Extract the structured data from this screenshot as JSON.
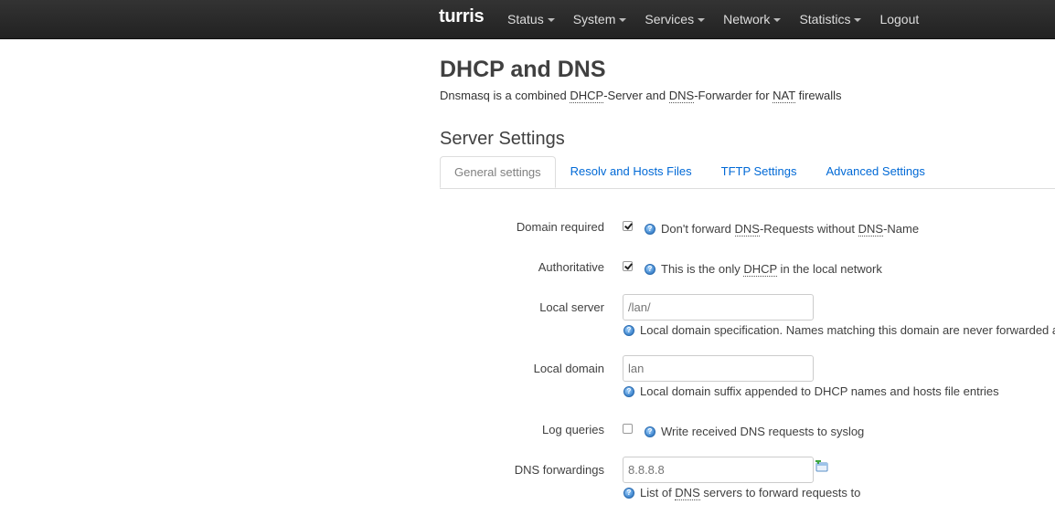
{
  "navbar": {
    "brand": "turris",
    "items": [
      {
        "label": "Status",
        "dropdown": true
      },
      {
        "label": "System",
        "dropdown": true
      },
      {
        "label": "Services",
        "dropdown": true
      },
      {
        "label": "Network",
        "dropdown": true
      },
      {
        "label": "Statistics",
        "dropdown": true
      },
      {
        "label": "Logout",
        "dropdown": false
      }
    ]
  },
  "page": {
    "title": "DHCP and DNS",
    "description": {
      "p1": "Dnsmasq is a combined ",
      "abbr1": "DHCP",
      "p2": "-Server and ",
      "abbr2": "DNS",
      "p3": "-Forwarder for ",
      "abbr3": "NAT",
      "p4": " firewalls"
    },
    "section_title": "Server Settings"
  },
  "tabs": [
    {
      "label": "General settings",
      "active": true
    },
    {
      "label": "Resolv and Hosts Files",
      "active": false
    },
    {
      "label": "TFTP Settings",
      "active": false
    },
    {
      "label": "Advanced Settings",
      "active": false
    }
  ],
  "fields": {
    "domain_required": {
      "label": "Domain required",
      "checked": true,
      "hint_p1": "Don't forward ",
      "hint_abbr1": "DNS",
      "hint_p2": "-Requests without ",
      "hint_abbr2": "DNS",
      "hint_p3": "-Name"
    },
    "authoritative": {
      "label": "Authoritative",
      "checked": true,
      "hint_p1": "This is the only ",
      "hint_abbr1": "DHCP",
      "hint_p2": " in the local network"
    },
    "local_server": {
      "label": "Local server",
      "placeholder": "/lan/",
      "hint": "Local domain specification. Names matching this domain are never forwarded a"
    },
    "local_domain": {
      "label": "Local domain",
      "placeholder": "lan",
      "hint": "Local domain suffix appended to DHCP names and hosts file entries"
    },
    "log_queries": {
      "label": "Log queries",
      "checked": false,
      "hint": "Write received DNS requests to syslog"
    },
    "dns_forwardings": {
      "label": "DNS forwardings",
      "placeholder": "8.8.8.8",
      "hint_p1": "List of ",
      "hint_abbr1": "DNS",
      "hint_p2": " servers to forward requests to"
    }
  },
  "icons": {
    "help": "help-icon",
    "add": "add-icon"
  },
  "colors": {
    "navbar": "#222222",
    "link": "#0069d6",
    "help_icon": "#4a8fd4"
  }
}
